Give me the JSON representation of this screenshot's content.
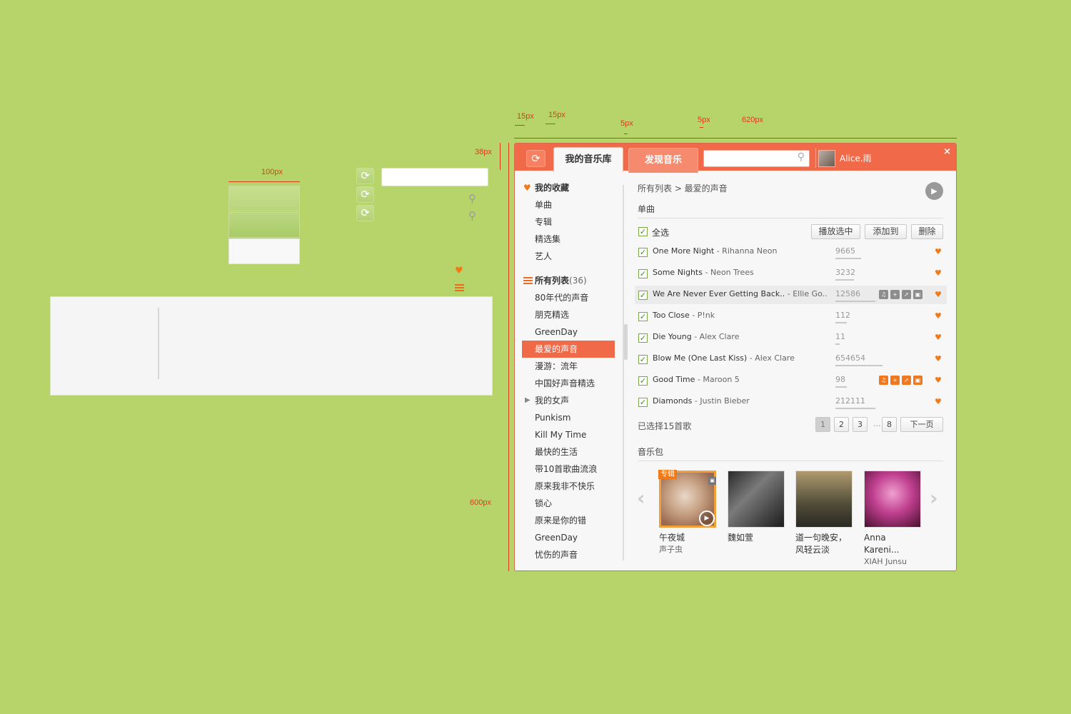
{
  "annotations": {
    "w15a": "15px",
    "w15b": "15px",
    "w5a": "5px",
    "w5b": "5px",
    "w620": "620px",
    "h38": "38px",
    "w100": "100px",
    "h24": "24px",
    "w150": "150px",
    "h600": "600px"
  },
  "colors": {
    "accent": "#f06a4a",
    "background": "#b7d46b",
    "heart": "#f07a1a"
  },
  "header": {
    "refresh_icon": "refresh-icon",
    "tab_library": "我的音乐库",
    "tab_discover": "发现音乐",
    "search_placeholder": "",
    "user_name": "Alice.雨",
    "close_label": "×"
  },
  "sidebar": {
    "favorites_title": "我的收藏",
    "favorites": [
      "单曲",
      "专辑",
      "精选集",
      "艺人"
    ],
    "lists_title": "所有列表",
    "lists_count": "(36)",
    "lists": [
      "80年代的声音",
      "朋克精选",
      "GreenDay",
      "最爱的声音",
      "漫游：流年",
      "中国好声音精选",
      "我的女声",
      "Punkism",
      "Kill My Time",
      "最快的生活",
      "带10首歌曲流浪",
      "原来我非不快乐",
      "锁心",
      "原来是你的错",
      "GreenDay",
      "忧伤的声音"
    ]
  },
  "main": {
    "breadcrumb": "所有列表 > 最爱的声音",
    "section_songs": "单曲",
    "select_all": "全选",
    "btn_play_selected": "播放选中",
    "btn_add_to": "添加到",
    "btn_delete": "删除",
    "songs": [
      {
        "title": "One More Night",
        "artist": " - Rihanna Neon",
        "plays": "9665"
      },
      {
        "title": "Some Nights",
        "artist": " - Neon Trees",
        "plays": "3232"
      },
      {
        "title": "We Are Never Ever Getting Back..",
        "artist": " - Ellie Go..",
        "plays": "12586"
      },
      {
        "title": "Too Close",
        "artist": " - P!nk",
        "plays": "112"
      },
      {
        "title": "Die Young",
        "artist": " - Alex Clare",
        "plays": "11"
      },
      {
        "title": "Blow Me (One Last Kiss)",
        "artist": " - Alex Clare",
        "plays": "654654"
      },
      {
        "title": "Good Time",
        "artist": " - Maroon 5",
        "plays": "98"
      },
      {
        "title": "Diamonds",
        "artist": " - Justin Bieber",
        "plays": "212111"
      }
    ],
    "selected_info": "已选择15首歌",
    "pages": [
      "1",
      "2",
      "3",
      "8"
    ],
    "ellipsis": "...",
    "next_page": "下一页",
    "section_packs": "音乐包",
    "album_badge": "专辑",
    "albums": [
      {
        "name": "午夜城",
        "artist": "声子虫"
      },
      {
        "name": "魏如萱",
        "artist": ""
      },
      {
        "name": "道一句晚安，风轻云淡",
        "artist": ""
      },
      {
        "name": "Anna Kareni...",
        "artist": "XIAH Junsu"
      }
    ]
  }
}
